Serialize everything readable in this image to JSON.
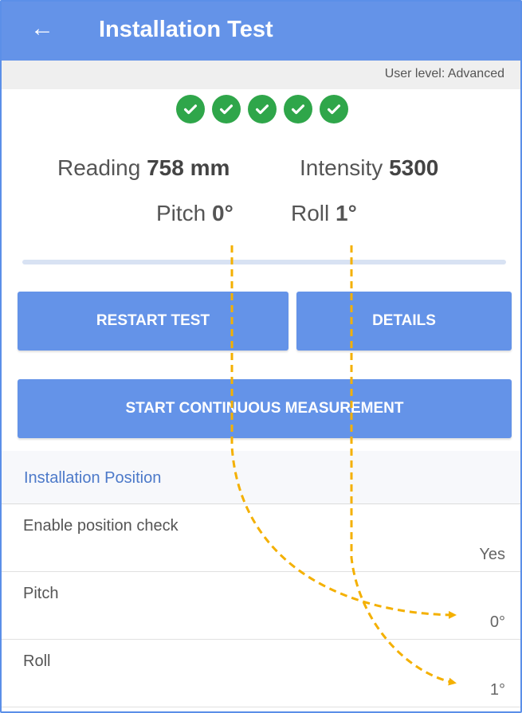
{
  "app": {
    "title": "Installation Test",
    "back_icon": "arrow-left-icon"
  },
  "user_level": "User level: Advanced",
  "status": {
    "checks": [
      true,
      true,
      true,
      true,
      true
    ],
    "check_color": "#2fa64a"
  },
  "readings": {
    "reading_label": "Reading",
    "reading_value": "758 mm",
    "intensity_label": "Intensity",
    "intensity_value": "5300",
    "pitch_label": "Pitch",
    "pitch_value": "0°",
    "roll_label": "Roll",
    "roll_value": "1°"
  },
  "buttons": {
    "restart": "RESTART TEST",
    "details": "DETAILS",
    "continuous": "START CONTINUOUS MEASUREMENT"
  },
  "section": {
    "title": "Installation Position",
    "rows": [
      {
        "label": "Enable position check",
        "value": "Yes"
      },
      {
        "label": "Pitch",
        "value": "0°"
      },
      {
        "label": "Roll",
        "value": "1°"
      }
    ]
  },
  "colors": {
    "accent": "#6493e8",
    "annotation": "#f4b000"
  }
}
